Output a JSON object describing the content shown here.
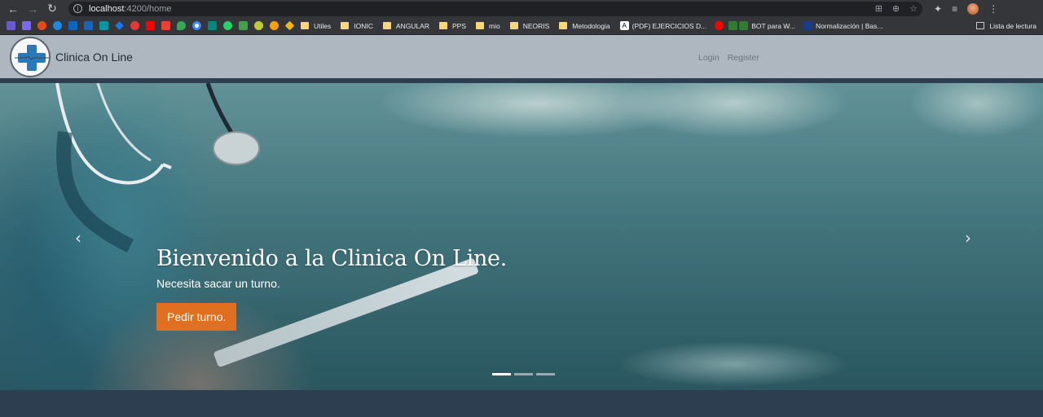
{
  "browser": {
    "url_host": "localhost",
    "url_path": ":4200/home",
    "bookmarks": [
      {
        "label": "Utiles"
      },
      {
        "label": "IONIC"
      },
      {
        "label": "ANGULAR"
      },
      {
        "label": "PPS"
      },
      {
        "label": "mio"
      },
      {
        "label": "NEORIS"
      },
      {
        "label": "Metodologia"
      }
    ],
    "bookmark_links": [
      {
        "label": "(PDF) EJERCICIOS D..."
      },
      {
        "label": "BOT para W..."
      },
      {
        "label": "Normalización | Bas..."
      }
    ],
    "reading_list": "Lista de lectura"
  },
  "navbar": {
    "brand": "Clinica On Line",
    "login": "Login",
    "register": "Register"
  },
  "hero": {
    "title": "Bienvenido a la Clinica On Line.",
    "subtitle": "Necesita sacar un turno.",
    "cta": "Pedir turno.",
    "prev_icon": "chevron-left-icon",
    "next_icon": "chevron-right-icon",
    "slides_total": 3,
    "active_slide": 1
  },
  "colors": {
    "accent": "#e07020",
    "navbar_bg": "#aeb6c0",
    "dark_band": "#2c3e50"
  }
}
